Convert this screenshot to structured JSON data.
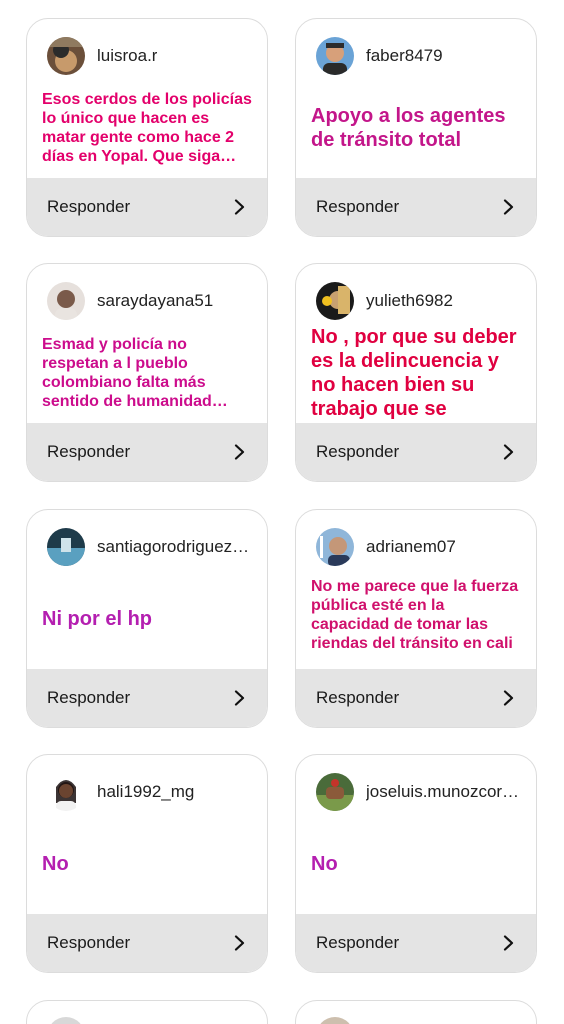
{
  "cards": [
    {
      "username": "luisroa.r",
      "message": "Esos cerdos de los policías lo único que hacen es matar gente como hace 2 días en Yopal. Que siga…",
      "reply_label": "Responder",
      "text_color": "#e3006b",
      "avatar_colors": [
        "#6b4f3a",
        "#c79a6b"
      ]
    },
    {
      "username": "faber8479",
      "message": "Apoyo a los agentes de tránsito  total",
      "reply_label": "Responder",
      "text_color": "#c3168a",
      "avatar_colors": [
        "#3a6fb0",
        "#d7a07a"
      ]
    },
    {
      "username": "saraydayana51",
      "message": "Esmad y policía no respetan a l pueblo colombiano falta más sentido de humanidad…",
      "reply_label": "Responder",
      "text_color": "#cc0c8c",
      "avatar_colors": [
        "#e6e0dc",
        "#7a5a4a"
      ]
    },
    {
      "username": "yulieth6982",
      "message": "No , por que su deber es la delincuencia y no hacen bien su trabajo que se dediquen a eso",
      "reply_label": "Responder",
      "text_color": "#e00040",
      "avatar_colors": [
        "#1a1a1a",
        "#c8a070"
      ]
    },
    {
      "username": "santiagorodriguez…",
      "message": "Ni por el hp",
      "reply_label": "Responder",
      "text_color": "#b41fb0",
      "avatar_colors": [
        "#1e3b4a",
        "#5aa0c0"
      ]
    },
    {
      "username": "adrianem07",
      "message": "No me parece que la fuerza pública esté en la capacidad de tomar las riendas del tránsito en cali",
      "reply_label": "Responder",
      "text_color": "#d0106c",
      "avatar_colors": [
        "#5a6f86",
        "#c49778"
      ]
    },
    {
      "username": "hali1992_mg",
      "message": "No",
      "reply_label": "Responder",
      "text_color": "#b41fb0",
      "avatar_colors": [
        "#ffffff",
        "#5a3a28"
      ]
    },
    {
      "username": "joseluis.munozcor…",
      "message": "No",
      "reply_label": "Responder",
      "text_color": "#b41fb0",
      "avatar_colors": [
        "#4a6b3a",
        "#8b5a3a"
      ]
    }
  ]
}
